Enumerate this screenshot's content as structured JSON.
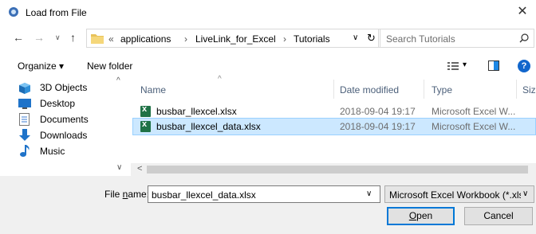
{
  "window": {
    "title": "Load from File",
    "close_glyph": "✕"
  },
  "nav": {
    "back": "←",
    "forward": "→",
    "up": "↑"
  },
  "address": {
    "prefix": "«",
    "segments": [
      "applications",
      "LiveLink_for_Excel",
      "Tutorials"
    ],
    "separator": "›",
    "dropdown": "∨",
    "refresh": "↻"
  },
  "search": {
    "placeholder": "Search Tutorials",
    "icon": "⌕"
  },
  "toolbar": {
    "organize_label": "Organize ▾",
    "new_folder_label": "New folder",
    "view_label": "▾",
    "help": "?"
  },
  "sidebar": {
    "items": [
      {
        "label": "3D Objects",
        "icon": "cube-icon"
      },
      {
        "label": "Desktop",
        "icon": "desktop-icon"
      },
      {
        "label": "Documents",
        "icon": "document-icon"
      },
      {
        "label": "Downloads",
        "icon": "download-icon"
      },
      {
        "label": "Music",
        "icon": "music-icon"
      }
    ]
  },
  "columns": {
    "name": "Name",
    "date": "Date modified",
    "type": "Type",
    "size": "Size"
  },
  "files": [
    {
      "name": "busbar_llexcel.xlsx",
      "date": "2018-09-04 19:17",
      "type": "Microsoft Excel W..."
    },
    {
      "name": "busbar_llexcel_data.xlsx",
      "date": "2018-09-04 19:17",
      "type": "Microsoft Excel W..."
    }
  ],
  "footer": {
    "filename_label_pre": "File ",
    "filename_label_u": "n",
    "filename_label_post": "ame:",
    "filename_value": "busbar_llexcel_data.xlsx",
    "filetype_value": "Microsoft Excel Workbook (*.xls",
    "open_u": "O",
    "open_rest": "pen",
    "cancel_label": "Cancel"
  },
  "colors": {
    "selection": "#cce8ff",
    "selection_border": "#99d1ff",
    "excel_green": "#1f7246",
    "accent": "#0078d7"
  }
}
